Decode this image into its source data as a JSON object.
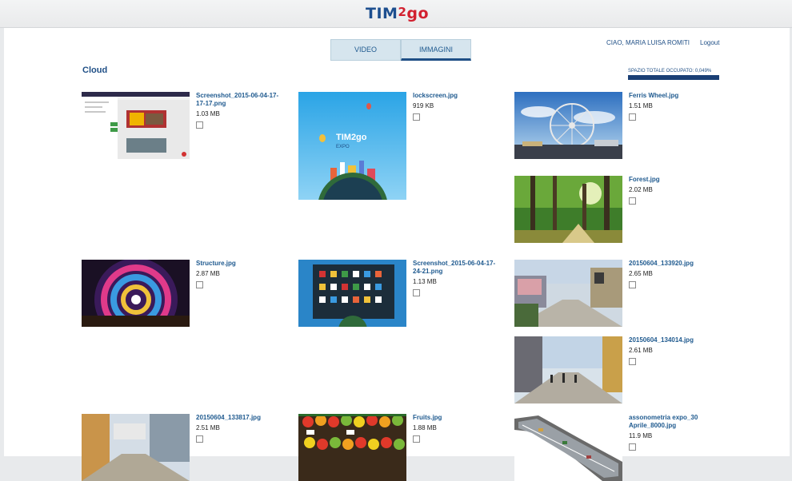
{
  "app": {
    "logo_main": "TIM",
    "logo_two": "2",
    "logo_go": "go"
  },
  "tabs": [
    {
      "label": "VIDEO",
      "active": false
    },
    {
      "label": "IMMAGINI",
      "active": true
    }
  ],
  "user": {
    "greeting": "CIAO, MARIA LUISA ROMITI",
    "logout": "Logout"
  },
  "section": {
    "title": "Cloud"
  },
  "storage": {
    "label": "SPAZIO TOTALE OCCUPATO: 0,049%",
    "used_percent": 0.049
  },
  "files": [
    {
      "name": "Screenshot_2015-06-04-17-17-17.png",
      "size": "1.03 MB",
      "icon": "screenshot-thumbnail"
    },
    {
      "name": "lockscreen.jpg",
      "size": "919 KB",
      "icon": "lockscreen-thumbnail"
    },
    {
      "name": "Ferris Wheel.jpg",
      "size": "1.51 MB",
      "icon": "ferris-wheel-thumbnail"
    },
    {
      "name": "Forest.jpg",
      "size": "2.02 MB",
      "icon": "forest-thumbnail"
    },
    {
      "name": "Structure.jpg",
      "size": "2.87 MB",
      "icon": "structure-thumbnail"
    },
    {
      "name": "Screenshot_2015-06-04-17-24-21.png",
      "size": "1.13 MB",
      "icon": "screenshot-thumbnail"
    },
    {
      "name": "20150604_133920.jpg",
      "size": "2.65 MB",
      "icon": "street-thumbnail"
    },
    {
      "name": "20150604_134014.jpg",
      "size": "2.61 MB",
      "icon": "street-thumbnail"
    },
    {
      "name": "20150604_133817.jpg",
      "size": "2.51 MB",
      "icon": "street-thumbnail"
    },
    {
      "name": "Fruits.jpg",
      "size": "1.88 MB",
      "icon": "fruits-thumbnail"
    },
    {
      "name": "assonometria expo_30 Aprile_8000.jpg",
      "size": "11.9 MB",
      "icon": "map-thumbnail"
    }
  ],
  "colors": {
    "accent": "#1f4f86",
    "tab_bg": "#d6e5ee",
    "logo_red": "#d2202f"
  }
}
